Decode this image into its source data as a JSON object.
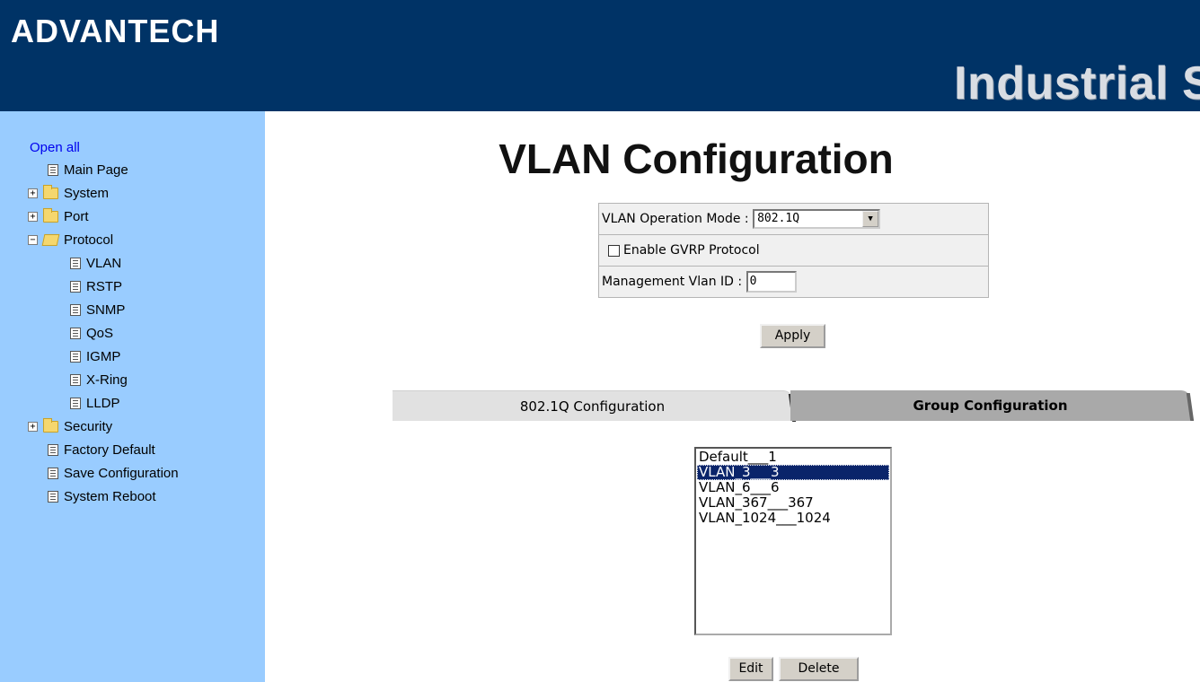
{
  "header": {
    "logo": "ADVANTECH",
    "product_title": "Industrial S"
  },
  "sidebar": {
    "open_all": "Open all",
    "items": [
      {
        "label": "Main Page",
        "icon": "page-icon"
      },
      {
        "label": "System",
        "icon": "folder-icon",
        "toggle": "+"
      },
      {
        "label": "Port",
        "icon": "folder-icon",
        "toggle": "+"
      },
      {
        "label": "Protocol",
        "icon": "folder-open-icon",
        "toggle": "−"
      },
      {
        "label": "VLAN",
        "icon": "page-icon"
      },
      {
        "label": "RSTP",
        "icon": "page-icon"
      },
      {
        "label": "SNMP",
        "icon": "page-icon"
      },
      {
        "label": "QoS",
        "icon": "page-icon"
      },
      {
        "label": "IGMP",
        "icon": "page-icon"
      },
      {
        "label": "X-Ring",
        "icon": "page-icon"
      },
      {
        "label": "LLDP",
        "icon": "page-icon"
      },
      {
        "label": "Security",
        "icon": "folder-icon",
        "toggle": "+"
      },
      {
        "label": "Factory Default",
        "icon": "page-icon"
      },
      {
        "label": "Save Configuration",
        "icon": "page-icon"
      },
      {
        "label": "System Reboot",
        "icon": "page-icon"
      }
    ]
  },
  "main": {
    "title": "VLAN Configuration",
    "operation_mode": {
      "label": "VLAN Operation Mode :",
      "value": "802.1Q"
    },
    "gvrp": {
      "label": "Enable GVRP Protocol",
      "checked": false
    },
    "management_vlan": {
      "label": "Management Vlan ID :",
      "value": "0"
    },
    "apply_label": "Apply",
    "tabs": [
      {
        "label": "802.1Q Configuration",
        "active": false
      },
      {
        "label": "Group Configuration",
        "active": true
      }
    ],
    "group_list": [
      {
        "text": "Default___1",
        "selected": false
      },
      {
        "text": "VLAN_3___3",
        "selected": true
      },
      {
        "text": "VLAN_6___6",
        "selected": false
      },
      {
        "text": "VLAN_367___367",
        "selected": false
      },
      {
        "text": "VLAN_1024___1024",
        "selected": false
      }
    ],
    "edit_label": "Edit",
    "delete_label": "Delete"
  },
  "colors": {
    "header_bg": "#003366",
    "sidebar_bg": "#99ccff",
    "selection": "#0a246a",
    "link": "#0000ee"
  }
}
